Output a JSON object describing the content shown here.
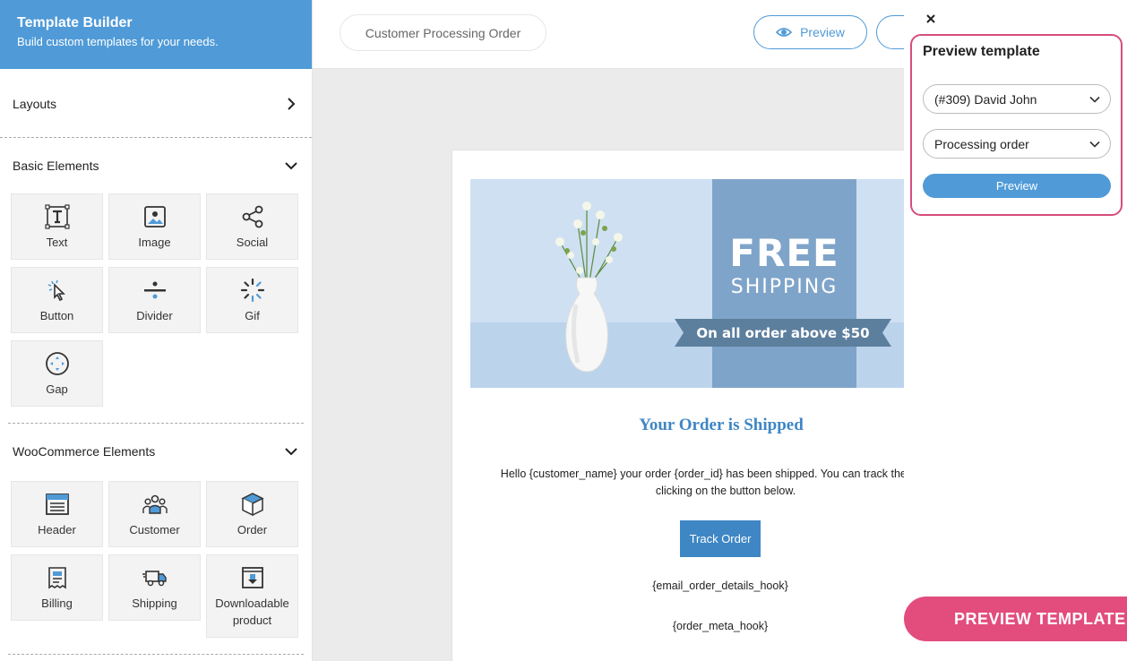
{
  "sidebar": {
    "title": "Template Builder",
    "subtitle": "Build custom templates for your needs.",
    "layouts_label": "Layouts",
    "basic": {
      "label": "Basic Elements",
      "items": [
        {
          "label": "Text",
          "icon": "text-icon"
        },
        {
          "label": "Image",
          "icon": "image-icon"
        },
        {
          "label": "Social",
          "icon": "share-icon"
        },
        {
          "label": "Button",
          "icon": "pointer-icon"
        },
        {
          "label": "Divider",
          "icon": "divider-icon"
        },
        {
          "label": "Gif",
          "icon": "loader-icon"
        },
        {
          "label": "Gap",
          "icon": "gap-icon"
        }
      ]
    },
    "woo": {
      "label": "WooCommerce Elements",
      "items": [
        {
          "label": "Header",
          "icon": "header-icon"
        },
        {
          "label": "Customer",
          "icon": "customer-icon"
        },
        {
          "label": "Order",
          "icon": "box-icon"
        },
        {
          "label": "Billing",
          "icon": "receipt-icon"
        },
        {
          "label": "Shipping",
          "icon": "truck-icon"
        },
        {
          "label": "Downloadable product",
          "icon": "download-icon"
        }
      ]
    }
  },
  "topbar": {
    "template_name": "Customer Processing Order",
    "preview_label": "Preview"
  },
  "canvas": {
    "banner": {
      "free": "FREE",
      "shipping": "SHIPPING",
      "ribbon": "On all order above $50"
    },
    "heading": "Your Order is Shipped",
    "body": "Hello {customer_name} your order {order_id} has been shipped. You can track the order by clicking on the button below.",
    "button": "Track Order",
    "hook1": "{email_order_details_hook}",
    "hook2": "{order_meta_hook}"
  },
  "preview_panel": {
    "title": "Preview template",
    "customer_select": "(#309) David John",
    "status_select": "Processing order",
    "button": "Preview"
  },
  "cta": "PREVIEW TEMPLATE",
  "colors": {
    "brand_blue": "#4f9ad7",
    "accent_pink": "#e24d7e"
  }
}
